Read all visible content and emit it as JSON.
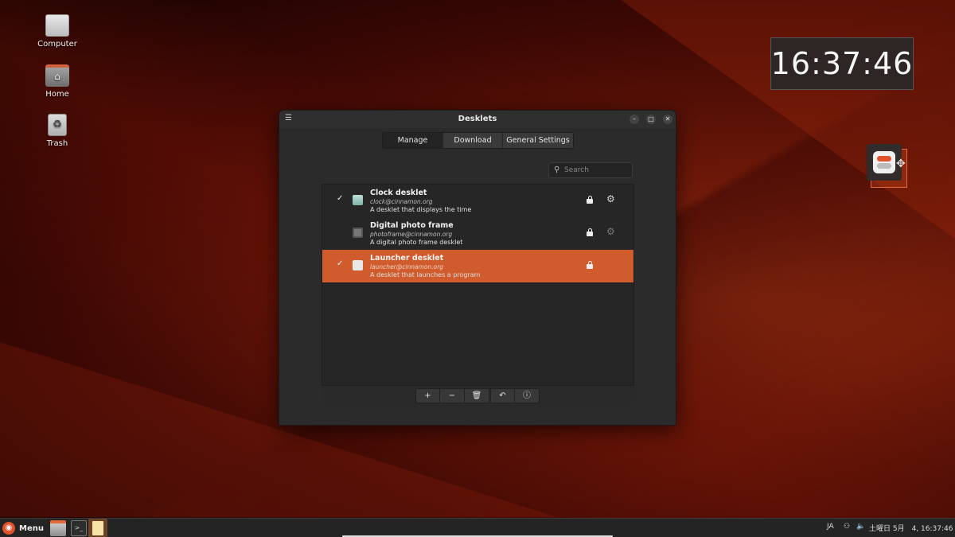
{
  "desktop": {
    "icons": [
      {
        "label": "Computer"
      },
      {
        "label": "Home"
      },
      {
        "label": "Trash"
      }
    ]
  },
  "clock_desklet": {
    "time": "16:37:46"
  },
  "window": {
    "title": "Desklets",
    "tabs": [
      {
        "label": "Manage",
        "active": true
      },
      {
        "label": "Download",
        "active": false
      },
      {
        "label": "General Settings",
        "active": false
      }
    ],
    "search": {
      "placeholder": "Search"
    },
    "desklets": [
      {
        "name": "Clock desklet",
        "uuid": "clock@cinnamon.org",
        "description": "A desklet that displays the time",
        "enabled": true,
        "selected": false
      },
      {
        "name": "Digital photo frame",
        "uuid": "photoframe@cinnamon.org",
        "description": "A digital photo frame desklet",
        "enabled": false,
        "selected": false
      },
      {
        "name": "Launcher desklet",
        "uuid": "launcher@cinnamon.org",
        "description": "A desklet that launches a program",
        "enabled": true,
        "selected": true
      }
    ],
    "toolbar": {
      "add": "+",
      "remove": "−",
      "restore": "↶",
      "info": "ⓘ"
    }
  },
  "taskbar": {
    "menu_label": "Menu",
    "keyboard_layout": "JA",
    "datetime": "土曜日 5月　4, 16:37:46"
  },
  "colors": {
    "accent": "#d05b2c",
    "window_bg": "#2b2b2b"
  }
}
